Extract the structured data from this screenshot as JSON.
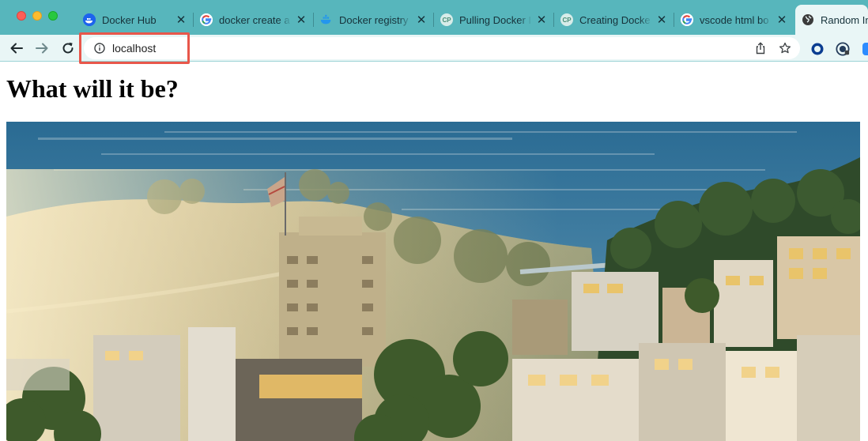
{
  "browser": {
    "tabs": [
      {
        "title": "Docker Hub",
        "favicon": "docker-icon",
        "active": false
      },
      {
        "title": "docker create a",
        "favicon": "google-icon",
        "active": false
      },
      {
        "title": "Docker registry",
        "favicon": "docker-docs-icon",
        "active": false
      },
      {
        "title": "Pulling Docker I",
        "favicon": "cp-icon",
        "active": false
      },
      {
        "title": "Creating Docke",
        "favicon": "cp-icon",
        "active": false
      },
      {
        "title": "vscode html bo",
        "favicon": "google-icon",
        "active": false
      },
      {
        "title": "Random Im",
        "favicon": "globe-icon",
        "active": true
      }
    ],
    "address_bar": {
      "url": "localhost"
    },
    "colors": {
      "tab_strip": "#57b6bc",
      "toolbar": "#e9f6f6",
      "highlight": "#e8574b"
    }
  },
  "page": {
    "heading": "What will it be?",
    "image": {
      "subject": "San Francisco hillside cityscape with flag at sunset"
    }
  }
}
